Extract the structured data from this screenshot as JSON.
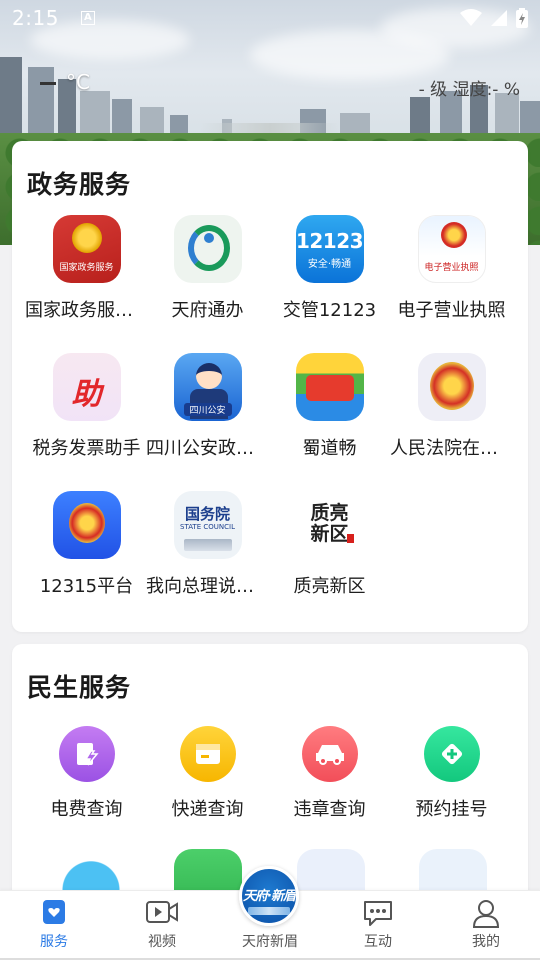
{
  "status_bar": {
    "time": "2:15",
    "indicator_letter": "A"
  },
  "weather": {
    "temperature": "°C",
    "level_humidity": "- 级 湿度:- %"
  },
  "gov_services": {
    "title": "政务服务",
    "items": [
      {
        "label": "国家政务服务平台",
        "icon": "national-emblem-icon",
        "icon_text": "国家政务服务"
      },
      {
        "label": "天府通办",
        "icon": "tianfu-icon"
      },
      {
        "label": "交管12123",
        "icon": "traffic-12123-icon",
        "icon_text": "12123",
        "icon_sub": "安全·畅通"
      },
      {
        "label": "电子营业执照",
        "icon": "business-license-icon",
        "icon_text": "电子营业执照"
      },
      {
        "label": "税务发票助手",
        "icon": "tax-invoice-icon",
        "icon_text": "助"
      },
      {
        "label": "四川公安政务服务",
        "icon": "police-icon",
        "icon_text": "四川公安"
      },
      {
        "label": "蜀道畅",
        "icon": "shudao-icon"
      },
      {
        "label": "人民法院在线服务",
        "icon": "court-emblem-icon"
      },
      {
        "label": "12315平台",
        "icon": "emblem-12315-icon"
      },
      {
        "label": "我向总理说句话",
        "icon": "state-council-icon",
        "icon_text": "国务院",
        "icon_sub": "STATE COUNCIL"
      },
      {
        "label": "质亮新区",
        "icon": "zhiliang-icon",
        "icon_text": "质亮新区"
      }
    ]
  },
  "life_services": {
    "title": "民生服务",
    "items": [
      {
        "label": "电费查询",
        "icon": "electricity-bill-icon"
      },
      {
        "label": "快递查询",
        "icon": "express-box-icon"
      },
      {
        "label": "违章查询",
        "icon": "car-violation-icon"
      },
      {
        "label": "预约挂号",
        "icon": "medical-appointment-icon"
      }
    ]
  },
  "bottom_nav": {
    "items": [
      {
        "label": "服务",
        "icon": "service-icon",
        "active": true
      },
      {
        "label": "视频",
        "icon": "video-icon",
        "active": false
      },
      {
        "label": "天府新眉",
        "icon": "tianfu-xinmei-logo",
        "active": false,
        "badge_text": "天府·新眉"
      },
      {
        "label": "互动",
        "icon": "chat-icon",
        "active": false
      },
      {
        "label": "我的",
        "icon": "profile-icon",
        "active": false
      }
    ]
  },
  "colors": {
    "accent": "#2c7be5",
    "card_bg": "#ffffff",
    "page_bg": "#f1f1f3"
  }
}
